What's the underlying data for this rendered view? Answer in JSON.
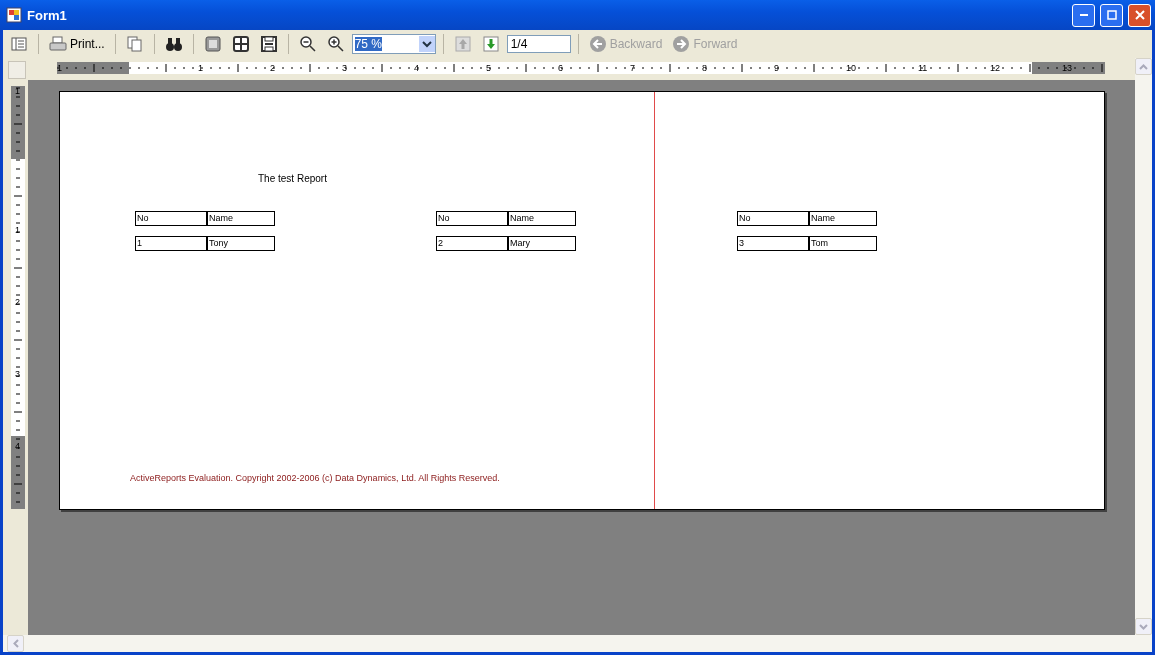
{
  "window": {
    "title": "Form1"
  },
  "toolbar": {
    "print": "Print...",
    "zoom": "75 %",
    "page": "1/4",
    "backward": {
      "label": "Backward",
      "disabled": true
    },
    "forward": {
      "label": "Forward",
      "disabled": true
    },
    "previous_page_disabled": true
  },
  "rulers": {
    "horizontal": [
      "1",
      "1",
      "2",
      "3",
      "4",
      "5",
      "6",
      "7",
      "8",
      "9",
      "10",
      "11",
      "12",
      "13"
    ],
    "vertical": [
      "1",
      "1",
      "2",
      "3",
      "4"
    ]
  },
  "report": {
    "title": "The test Report",
    "records": [
      {
        "header": [
          "No",
          "Name"
        ],
        "row": [
          "1",
          "Tony"
        ]
      },
      {
        "header": [
          "No",
          "Name"
        ],
        "row": [
          "2",
          "Mary"
        ]
      },
      {
        "header": [
          "No",
          "Name"
        ],
        "row": [
          "3",
          "Tom"
        ]
      }
    ],
    "footer": "ActiveReports Evaluation. Copyright 2002-2006 (c) Data Dynamics, Ltd. All Rights Reserved."
  }
}
